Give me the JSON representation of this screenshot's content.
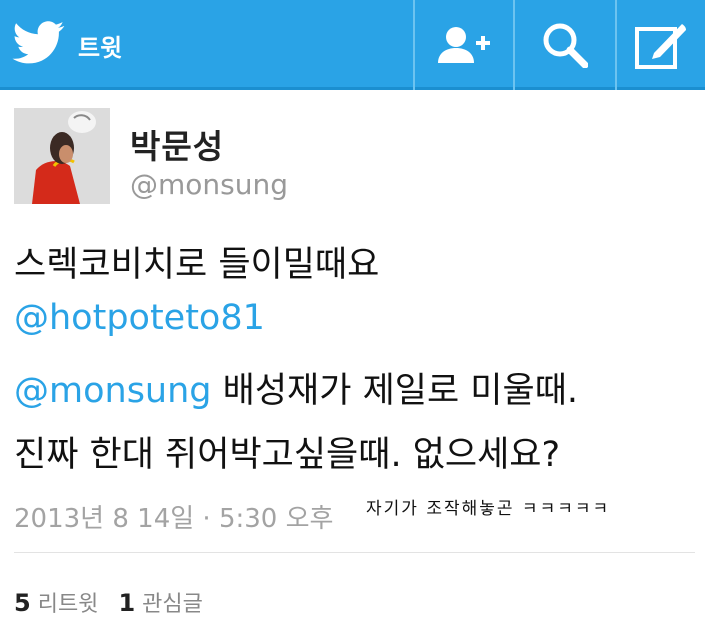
{
  "header": {
    "app_title": "트윗",
    "icons": [
      "twitter-bird-icon",
      "add-user-icon",
      "search-icon",
      "compose-icon"
    ]
  },
  "tweet": {
    "display_name": "박문성",
    "username": "@monsung",
    "line1": "스렉코비치로 들이밀때요",
    "line2_mention": "@hotpoteto81",
    "line3_mention": "@monsung",
    "line3_text": " 배성재가 제일로 미울때.",
    "line4": "진짜 한대 쥐어박고싶을때. 없으세요?",
    "timestamp": "2013년 8 14일 · 5:30 오후"
  },
  "annotation": {
    "caption": "자기가 조작해놓곤 ㅋㅋㅋㅋㅋ"
  },
  "stats": {
    "retweet_count": "5",
    "retweet_label": "리트윗",
    "favorite_count": "1",
    "favorite_label": "관심글"
  },
  "colors": {
    "header_bg": "#2aa3e6",
    "mention": "#2aa3e6"
  }
}
